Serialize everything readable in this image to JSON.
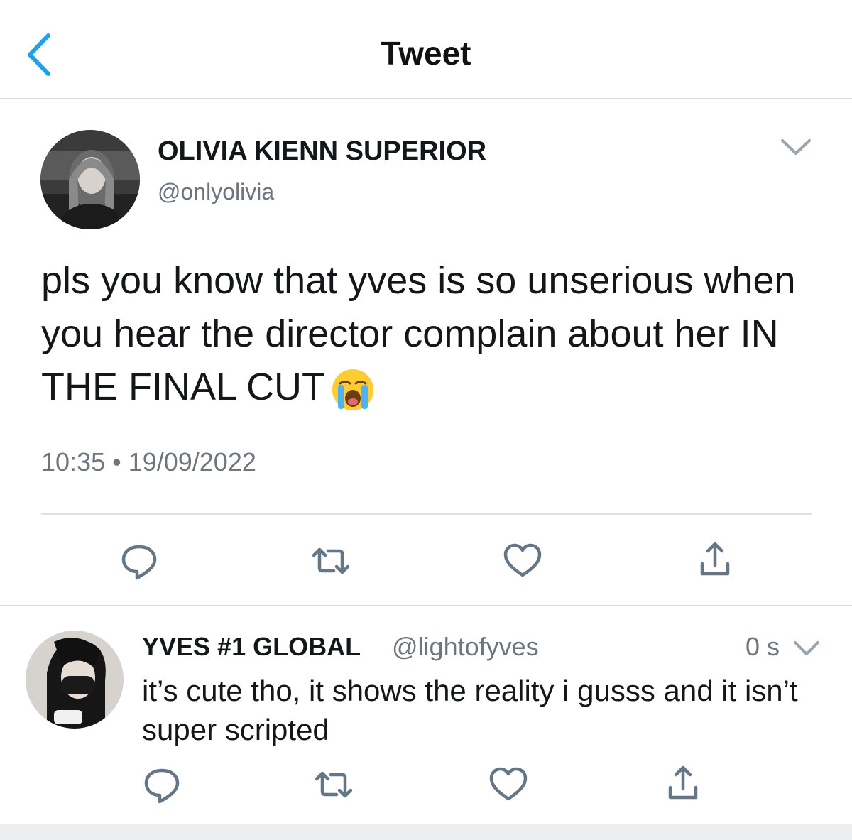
{
  "header": {
    "title": "Tweet",
    "back_icon": "chevron-left-icon"
  },
  "colors": {
    "accent": "#1da1f2",
    "text_primary": "#14171a",
    "text_secondary": "#6e767d",
    "divider": "#e1e1e1",
    "icon_gray": "#657786"
  },
  "main_tweet": {
    "display_name": "OLIVIA KIENN SUPERIOR",
    "handle": "@onlyolivia",
    "text": "pls you know that yves is so unserious when you hear the director complain about her IN THE FINAL CUT",
    "emoji": "loudly-crying-face-emoji",
    "timestamp": "10:35 • 19/09/2022",
    "actions": [
      "reply-icon",
      "retweet-icon",
      "like-icon",
      "share-icon"
    ]
  },
  "reply": {
    "display_name": "YVES #1 GLOBAL",
    "handle": "@lightofyves",
    "time": "0 s",
    "text": "it’s cute tho, it shows the reality i gusss and it isn’t super scripted",
    "actions": [
      "reply-icon",
      "retweet-icon",
      "like-icon",
      "share-icon"
    ]
  }
}
